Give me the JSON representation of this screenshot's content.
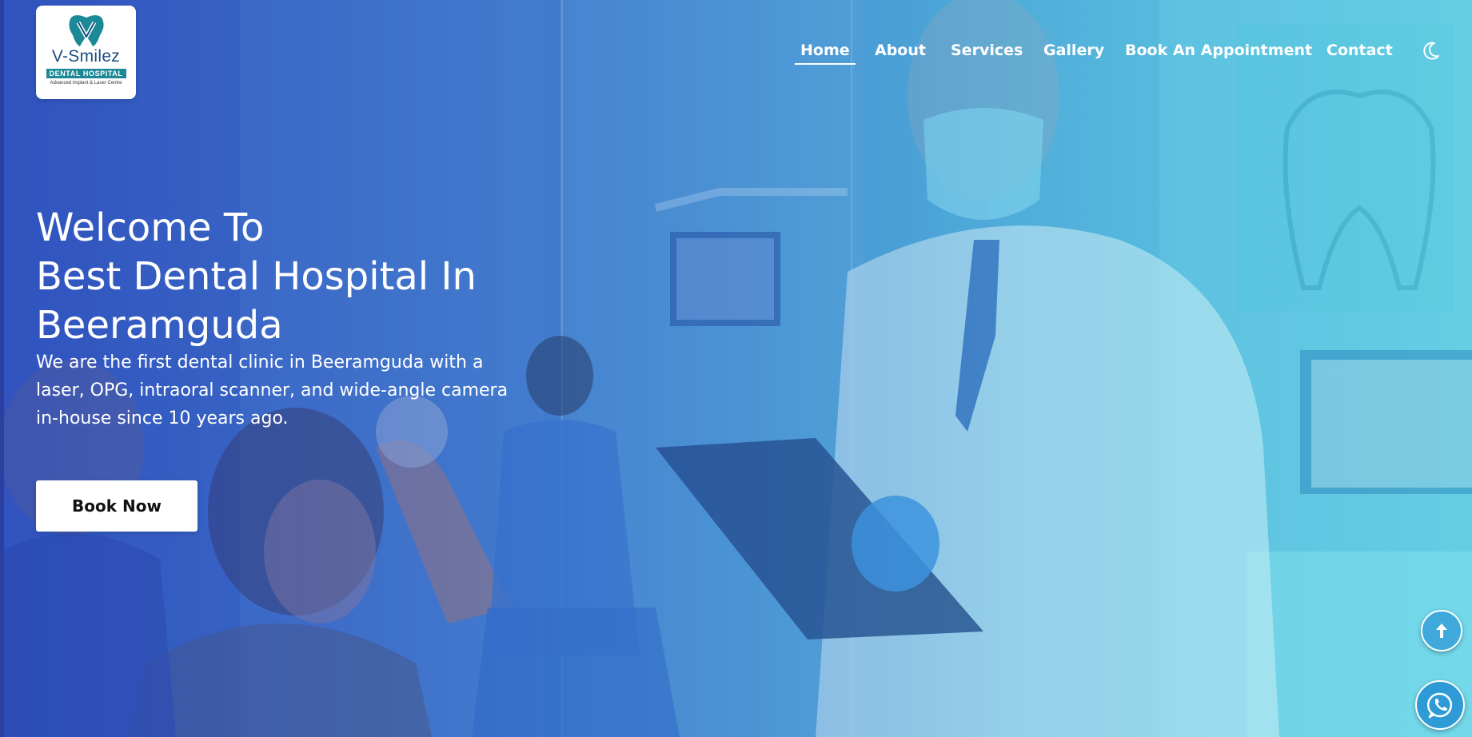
{
  "logo": {
    "name": "V-Smilez",
    "subtitle": "DENTAL HOSPITAL",
    "tagline": "Advanced Implant & Laser Centre",
    "icon": "tooth-icon"
  },
  "nav": {
    "items": [
      {
        "label": "Home",
        "active": true
      },
      {
        "label": "About"
      },
      {
        "label": "Services"
      },
      {
        "label": "Gallery"
      },
      {
        "label": "Book An Appointment"
      },
      {
        "label": "Contact"
      }
    ],
    "theme_toggle_icon": "moon-icon"
  },
  "hero": {
    "title_lines": [
      "Welcome To",
      "Best Dental Hospital In",
      "Beeramguda"
    ],
    "description": "We are the first dental clinic in Beeramguda with a laser, OPG, intraoral scanner, and wide-angle camera in-house since 10 years ago.",
    "cta_label": "Book Now"
  },
  "floating": {
    "scroll_top_icon": "arrow-up-icon",
    "whatsapp_icon": "whatsapp-icon"
  },
  "colors": {
    "overlay_left": "#3350b8",
    "overlay_right": "#66e0ea",
    "logo_accent": "#1c8a96",
    "button_bg": "#ffffff"
  }
}
